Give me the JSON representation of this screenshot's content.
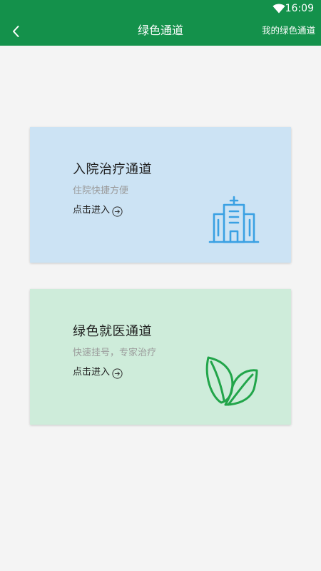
{
  "status_bar": {
    "time": "16:09",
    "wifi_icon": "wifi-icon"
  },
  "nav": {
    "back_icon": "chevron-left-icon",
    "title": "绿色通道",
    "right_link": "我的绿色通道"
  },
  "cards": [
    {
      "title": "入院治疗通道",
      "subtitle": "住院快捷方便",
      "enter_label": "点击进入",
      "enter_icon": "arrow-right-circle-icon",
      "illustration": "hospital-building-icon",
      "background": "#cce3f4",
      "accent": "#3aa1e3"
    },
    {
      "title": "绿色就医通道",
      "subtitle": "快速挂号，专家治疗",
      "enter_label": "点击进入",
      "enter_icon": "arrow-right-circle-icon",
      "illustration": "leaf-icon",
      "background": "#ceecda",
      "accent": "#22a54a"
    }
  ],
  "colors": {
    "header": "#14914b",
    "page_background": "#f4f4f4"
  }
}
